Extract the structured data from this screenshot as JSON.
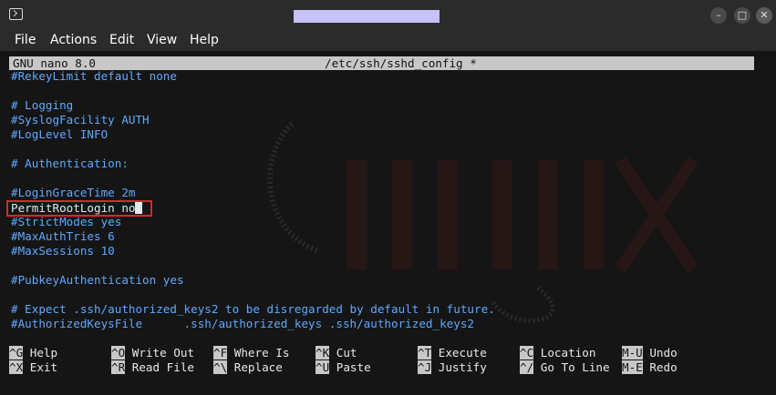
{
  "window": {
    "icons": {
      "app": "terminal-icon",
      "minimize": "minimize-icon",
      "maximize": "maximize-icon",
      "close": "close-icon"
    },
    "controls": {
      "minimize": "–",
      "maximize": "□",
      "close": "✕"
    }
  },
  "menu": [
    "File",
    "Actions",
    "Edit",
    "View",
    "Help"
  ],
  "nano": {
    "version": "GNU nano 8.0",
    "filename": "/etc/ssh/sshd_config *"
  },
  "lines": [
    "#RekeyLimit default none",
    "",
    "# Logging",
    "#SyslogFacility AUTH",
    "#LogLevel INFO",
    "",
    "# Authentication:",
    "",
    "#LoginGraceTime 2m",
    "PermitRootLogin no",
    "#StrictModes yes",
    "#MaxAuthTries 6",
    "#MaxSessions 10",
    "",
    "#PubkeyAuthentication yes",
    "",
    "# Expect .ssh/authorized_keys2 to be disregarded by default in future.",
    "#AuthorizedKeysFile      .ssh/authorized_keys .ssh/authorized_keys2"
  ],
  "shortcuts": [
    [
      {
        "key": "^G",
        "label": "Help"
      },
      {
        "key": "^X",
        "label": "Exit"
      }
    ],
    [
      {
        "key": "^O",
        "label": "Write Out"
      },
      {
        "key": "^R",
        "label": "Read File"
      }
    ],
    [
      {
        "key": "^F",
        "label": "Where Is"
      },
      {
        "key": "^\\",
        "label": "Replace"
      }
    ],
    [
      {
        "key": "^K",
        "label": "Cut"
      },
      {
        "key": "^U",
        "label": "Paste"
      }
    ],
    [
      {
        "key": "^T",
        "label": "Execute"
      },
      {
        "key": "^J",
        "label": "Justify"
      }
    ],
    [
      {
        "key": "^C",
        "label": "Location"
      },
      {
        "key": "^/",
        "label": "Go To Line"
      }
    ],
    [
      {
        "key": "M-U",
        "label": "Undo"
      },
      {
        "key": "M-E",
        "label": "Redo"
      }
    ]
  ],
  "colors": {
    "comment": "#5fa9ff",
    "plain": "#e8e8e8",
    "highlight_border": "#e0262a",
    "header_bg": "#c8c8c8",
    "background": "#151515"
  }
}
